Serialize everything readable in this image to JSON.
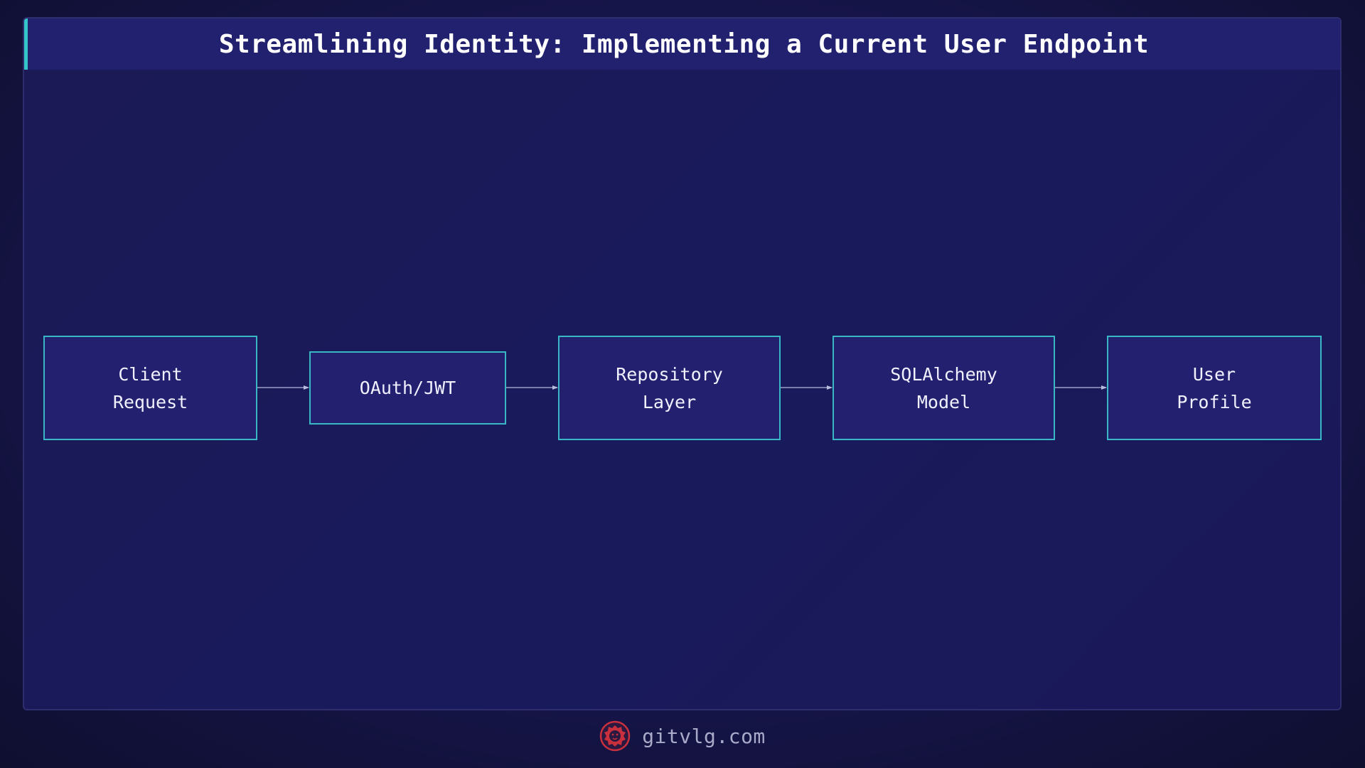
{
  "title": "Streamlining Identity: Implementing a Current User Endpoint",
  "diagram": {
    "nodes": [
      {
        "id": "client-request",
        "label": "Client\nRequest"
      },
      {
        "id": "oauth-jwt",
        "label": "OAuth/JWT"
      },
      {
        "id": "repository-layer",
        "label": "Repository\nLayer"
      },
      {
        "id": "sqlalchemy-model",
        "label": "SQLAlchemy\nModel"
      },
      {
        "id": "user-profile",
        "label": "User\nProfile"
      }
    ],
    "edges": [
      {
        "from": "client-request",
        "to": "oauth-jwt"
      },
      {
        "from": "oauth-jwt",
        "to": "repository-layer"
      },
      {
        "from": "repository-layer",
        "to": "sqlalchemy-model"
      },
      {
        "from": "sqlalchemy-model",
        "to": "user-profile"
      }
    ]
  },
  "footer": {
    "site": "gitvlg.com",
    "logo_icon": "lion-logo-icon"
  },
  "colors": {
    "background": "#16154a",
    "title_bar": "#222170",
    "accent": "#34c6c9",
    "node_border": "#38b8c4",
    "node_fill": "#22206f",
    "arrow": "#9aa0c8",
    "logo": "#c9303e"
  }
}
